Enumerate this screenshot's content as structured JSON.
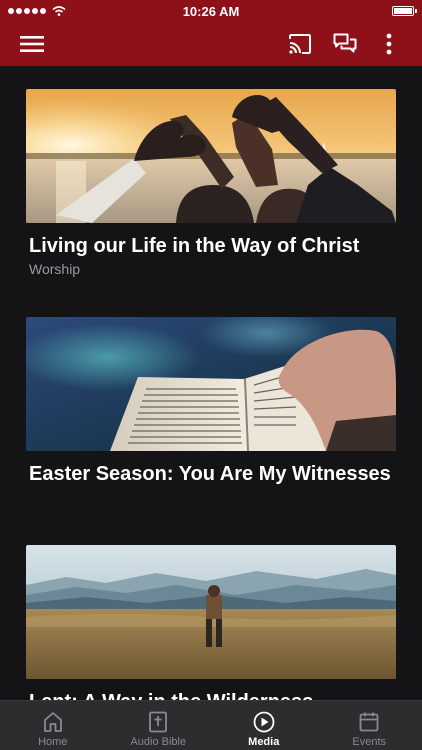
{
  "status": {
    "time": "10:26 AM"
  },
  "header": {
    "icons": [
      "menu-icon",
      "cast-icon",
      "chat-icon",
      "more-vert-icon"
    ]
  },
  "feed": {
    "items": [
      {
        "title": "Living our Life in the Way of Christ",
        "subtitle": "Worship",
        "image": "hands-heart-sunset"
      },
      {
        "title": "Easter Season: You Are My Witnesses",
        "subtitle": "",
        "image": "open-bible"
      },
      {
        "title": "Lent: A Way in the Wilderness",
        "subtitle": "",
        "image": "wilderness-mountains"
      }
    ]
  },
  "tabs": [
    {
      "label": "Home",
      "icon": "home-icon",
      "active": false
    },
    {
      "label": "Audio Bible",
      "icon": "bible-icon",
      "active": false
    },
    {
      "label": "Media",
      "icon": "play-circle-icon",
      "active": true
    },
    {
      "label": "Events",
      "icon": "calendar-icon",
      "active": false
    }
  ],
  "colors": {
    "brand": "#8e1018",
    "background": "#141416",
    "tabbar": "#2d2d30"
  }
}
